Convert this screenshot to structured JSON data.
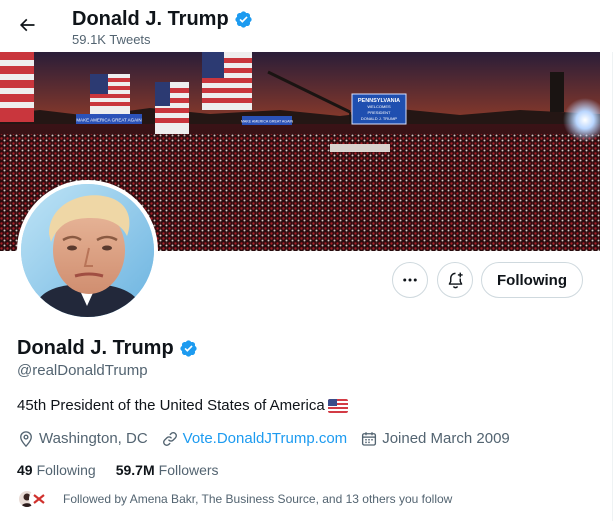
{
  "header": {
    "name": "Donald J. Trump",
    "tweet_count": "59.1K Tweets"
  },
  "banner": {
    "signs": [
      "MAKE AMERICA GREAT AGAIN",
      "MAKE AMERICA GREAT AGAIN"
    ],
    "screen_text": [
      "PENNSYLVANIA",
      "WELCOMES",
      "PRESIDENT",
      "DONALD J. TRUMP"
    ]
  },
  "actions": {
    "more_icon": "ellipsis-icon",
    "notify_icon": "bell-plus-icon",
    "following_label": "Following"
  },
  "profile": {
    "name": "Donald J. Trump",
    "handle": "@realDonaldTrump",
    "bio": "45th President of the United States of America",
    "bio_emoji": "us-flag-icon",
    "location": "Washington, DC",
    "website": "Vote.DonaldJTrump.com",
    "joined": "Joined March 2009",
    "following_count": "49",
    "following_label": "Following",
    "followers_count": "59.7M",
    "followers_label": "Followers",
    "followed_by": "Followed by Amena Bakr, The Business Source, and 13 others you follow"
  },
  "colors": {
    "accent": "#1d9bf0",
    "verified": "#1d9bf0",
    "text_primary": "#0f1419",
    "text_secondary": "#536471",
    "border": "#cfd9de"
  }
}
